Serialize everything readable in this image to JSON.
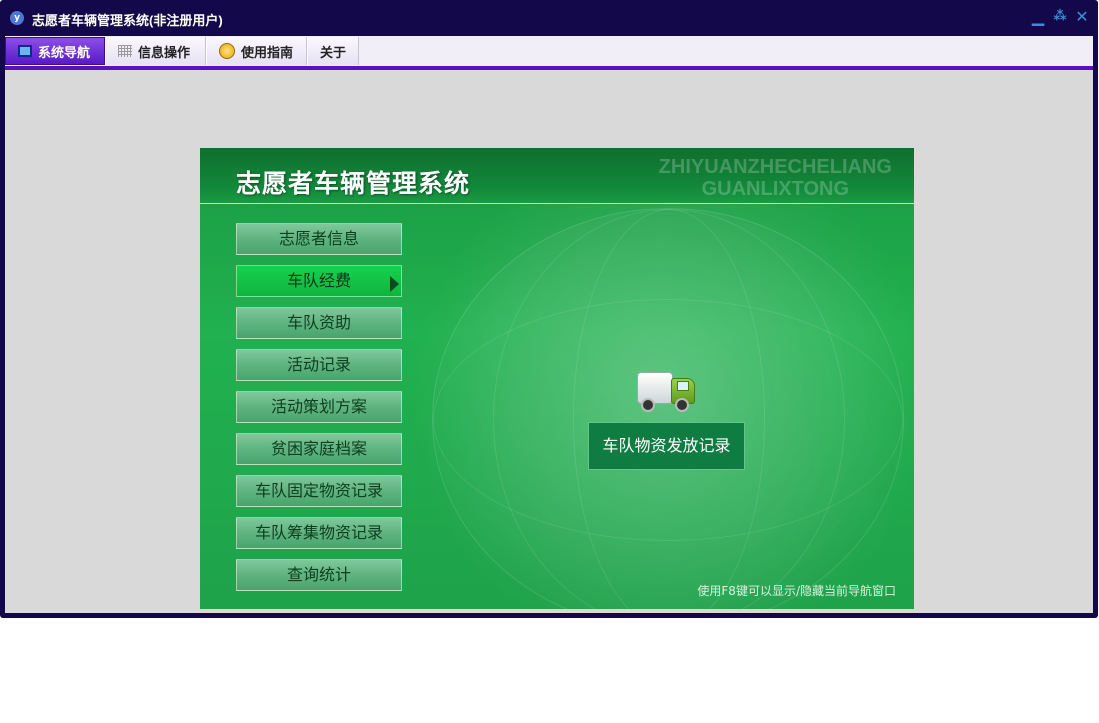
{
  "window": {
    "title": "志愿者车辆管理系统(非注册用户)",
    "app_icon_glyph": "y",
    "minimize_glyph": "▁",
    "restore_glyph": "⁂",
    "close_glyph": "✕"
  },
  "menu": {
    "tabs": [
      {
        "label": "系统导航",
        "icon": "monitor-icon"
      },
      {
        "label": "信息操作",
        "icon": "grid-icon"
      },
      {
        "label": "使用指南",
        "icon": "help-icon"
      },
      {
        "label": "关于",
        "icon": ""
      }
    ],
    "active_tab": "系统导航"
  },
  "panel": {
    "title": "志愿者车辆管理系统",
    "watermark_line1": "ZHIYUANZHECHELIANG",
    "watermark_line2": "GUANLIXTONG",
    "nav_items": [
      "志愿者信息",
      "车队经费",
      "车队资助",
      "活动记录",
      "活动策划方案",
      "贫困家庭档案",
      "车队固定物资记录",
      "车队筹集物资记录",
      "查询统计"
    ],
    "selected_nav": "车队经费",
    "action_label": "车队物资发放记录",
    "action_icon": "truck-icon",
    "hint": "使用F8键可以显示/隐藏当前导航窗口"
  },
  "colors": {
    "titlebar": "#13084a",
    "menu_accent": "#5a10bf",
    "panel_green": "#1ea24a",
    "client_bg": "#d9d9d9"
  }
}
